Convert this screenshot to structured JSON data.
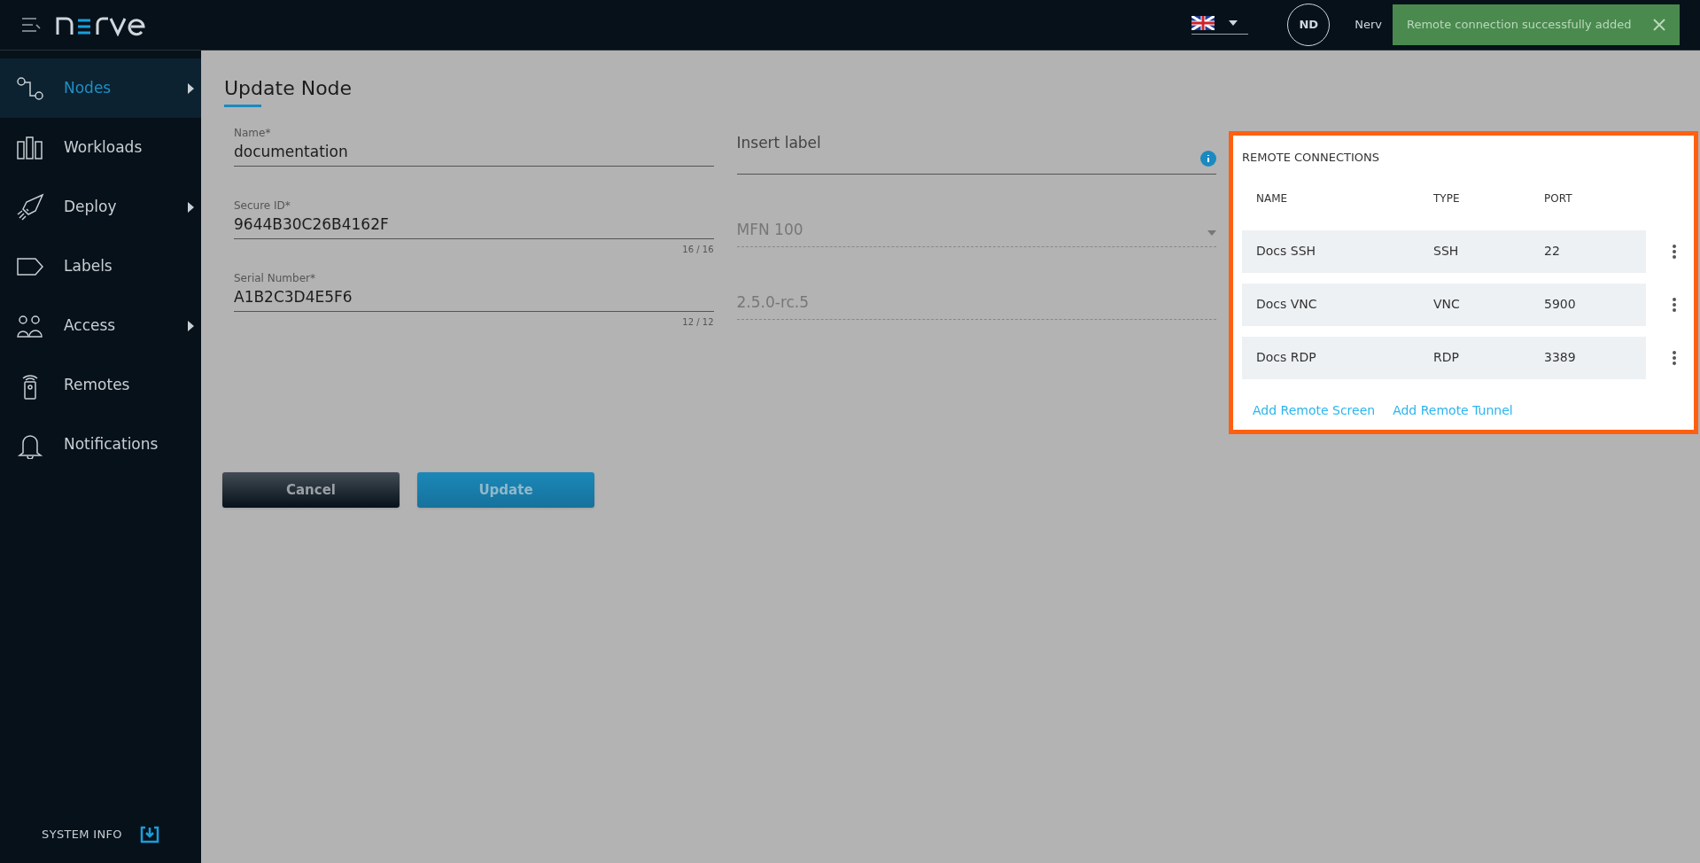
{
  "header": {
    "user_initials": "ND",
    "user_name": "Nerv"
  },
  "toast": {
    "message": "Remote connection successfully added"
  },
  "sidebar": {
    "items": [
      {
        "label": "Nodes",
        "selected": true,
        "has_submenu": true
      },
      {
        "label": "Workloads",
        "selected": false,
        "has_submenu": false
      },
      {
        "label": "Deploy",
        "selected": false,
        "has_submenu": true
      },
      {
        "label": "Labels",
        "selected": false,
        "has_submenu": false
      },
      {
        "label": "Access",
        "selected": false,
        "has_submenu": true
      },
      {
        "label": "Remotes",
        "selected": false,
        "has_submenu": false
      },
      {
        "label": "Notifications",
        "selected": false,
        "has_submenu": false
      }
    ],
    "footer": "SYSTEM INFO"
  },
  "form": {
    "title": "Update Node",
    "left_fields": [
      {
        "label": "Name*",
        "value": "documentation"
      },
      {
        "label": "Secure ID*",
        "value": "9644B30C26B4162F",
        "counter": "16 / 16"
      },
      {
        "label": "Serial Number*",
        "value": "A1B2C3D4E5F6",
        "counter": "12 / 12"
      }
    ],
    "right_fields": [
      {
        "kind": "labels",
        "placeholder": "Insert label",
        "disabled": false
      },
      {
        "kind": "select",
        "value": "MFN 100",
        "disabled": true
      },
      {
        "kind": "text",
        "value": "2.5.0-rc.5",
        "disabled": true
      }
    ],
    "buttons": [
      {
        "label": "Cancel",
        "kind": "secondary"
      },
      {
        "label": "Update",
        "kind": "primary"
      }
    ]
  },
  "remote_connections": {
    "title": "REMOTE CONNECTIONS",
    "columns": [
      "NAME",
      "TYPE",
      "PORT"
    ],
    "rows": [
      [
        "Docs SSH",
        "SSH",
        "22"
      ],
      [
        "Docs VNC",
        "VNC",
        "5900"
      ],
      [
        "Docs RDP",
        "RDP",
        "3389"
      ]
    ],
    "links": [
      "Add Remote Screen",
      "Add Remote Tunnel"
    ]
  }
}
